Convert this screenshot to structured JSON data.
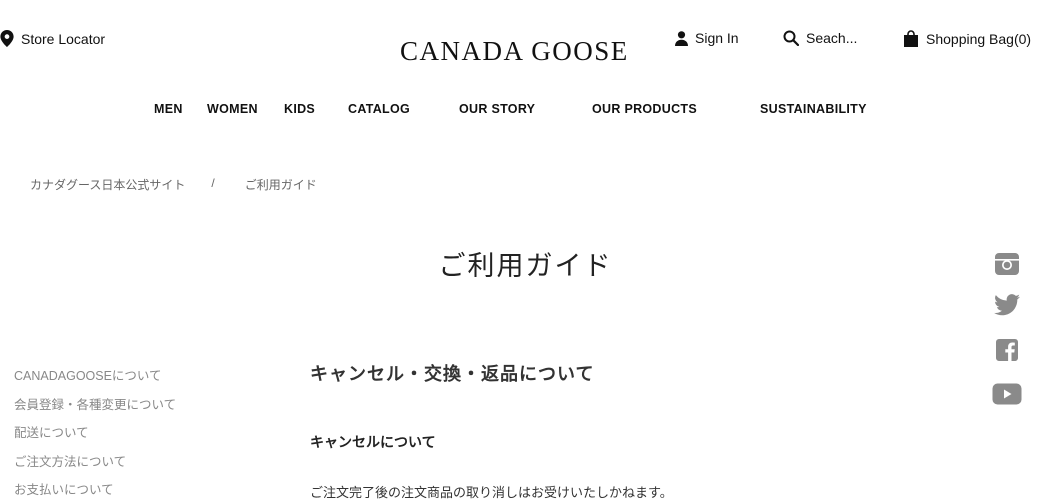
{
  "header": {
    "store_locator": "Store Locator",
    "logo": "CANADA GOOSE",
    "sign_in": "Sign In",
    "search_placeholder": "Seach...",
    "shopping_bag": "Shopping Bag(0)"
  },
  "nav": {
    "items": [
      "MEN",
      "WOMEN",
      "KIDS",
      "CATALOG",
      "OUR STORY",
      "OUR PRODUCTS",
      "SUSTAINABILITY"
    ]
  },
  "breadcrumb": {
    "home": "カナダグース日本公式サイト",
    "separator": "/",
    "current": "ご利用ガイド"
  },
  "page": {
    "title": "ご利用ガイド",
    "section_title": "キャンセル・交換・返品について",
    "sub_title": "キャンセルについて",
    "body_text": "ご注文完了後の注文商品の取り消しはお受けいたしかねます。"
  },
  "sidebar": {
    "items": [
      "CANADAGOOSEについて",
      "会員登録・各種変更について",
      "配送について",
      "ご注文方法について",
      "お支払いについて"
    ]
  },
  "social": {
    "icons": [
      "instagram-icon",
      "twitter-icon",
      "facebook-icon",
      "youtube-icon"
    ],
    "icon_color": "#8a8a8a"
  },
  "colors": {
    "text": "#222222",
    "muted": "#888888",
    "background": "#ffffff"
  }
}
